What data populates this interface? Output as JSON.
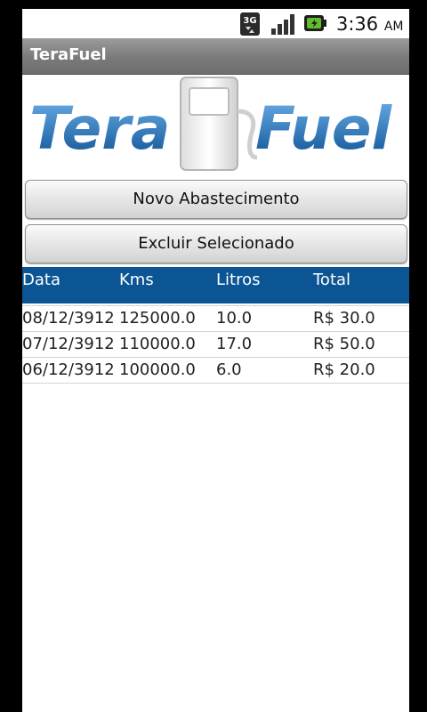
{
  "status_bar": {
    "network": "3G",
    "time": "3:36",
    "ampm": "AM",
    "icons": [
      "3g-icon",
      "signal-icon",
      "battery-icon"
    ]
  },
  "app": {
    "title": "TeraFuel",
    "logo_left": "Tera",
    "logo_right": "Fuel",
    "accent_color": "#0b5594"
  },
  "buttons": {
    "new_label": "Novo Abastecimento",
    "delete_label": "Excluir Selecionado"
  },
  "table": {
    "headers": [
      "Data",
      "Kms",
      "Litros",
      "Total"
    ],
    "rows": [
      [
        "08/12/3912",
        "125000.0",
        "10.0",
        "R$ 30.0"
      ],
      [
        "07/12/3912",
        "110000.0",
        "17.0",
        "R$ 50.0"
      ],
      [
        "06/12/3912",
        "100000.0",
        "6.0",
        "R$ 20.0"
      ]
    ]
  }
}
